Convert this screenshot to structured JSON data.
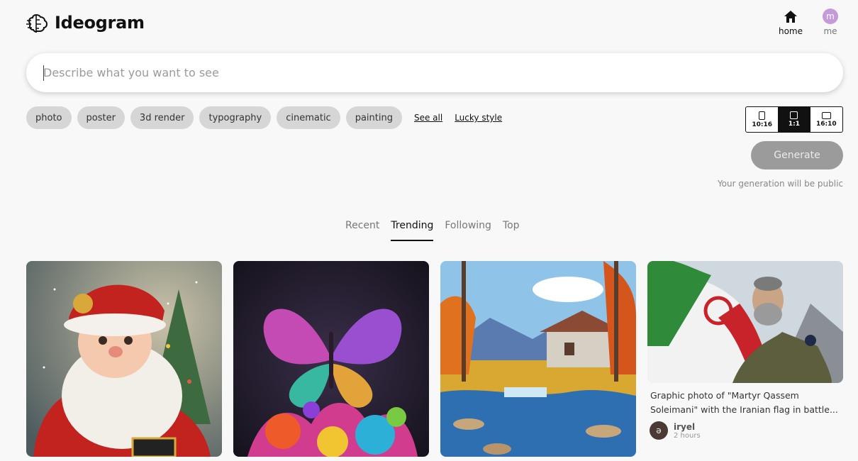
{
  "app": {
    "name": "Ideogram"
  },
  "nav": {
    "home_label": "home",
    "me_label": "me",
    "me_avatar_letter": "m"
  },
  "search": {
    "placeholder": "Describe what you want to see",
    "value": ""
  },
  "style_chips": [
    "photo",
    "poster",
    "3d render",
    "typography",
    "cinematic",
    "painting"
  ],
  "links": {
    "see_all": "See all",
    "lucky_style": "Lucky style"
  },
  "aspect_ratios": [
    {
      "label": "10:16",
      "shape": "portrait",
      "selected": false
    },
    {
      "label": "1:1",
      "shape": "square",
      "selected": true
    },
    {
      "label": "16:10",
      "shape": "landscape",
      "selected": false
    }
  ],
  "generate": {
    "label": "Generate",
    "note": "Your generation will be public"
  },
  "tabs": [
    {
      "label": "Recent",
      "active": false
    },
    {
      "label": "Trending",
      "active": true
    },
    {
      "label": "Following",
      "active": false
    },
    {
      "label": "Top",
      "active": false
    }
  ],
  "gallery": {
    "featured": {
      "caption": "Graphic photo of \"Martyr Qassem Soleimani\" with the Iranian flag in battle...",
      "author": "iryel",
      "author_initial": "ə",
      "time": "2 hours"
    }
  },
  "colors": {
    "generate_disabled": "#9b9b9b",
    "chip_bg": "#d6d6d6",
    "avatar_me": "#c59ad8"
  }
}
